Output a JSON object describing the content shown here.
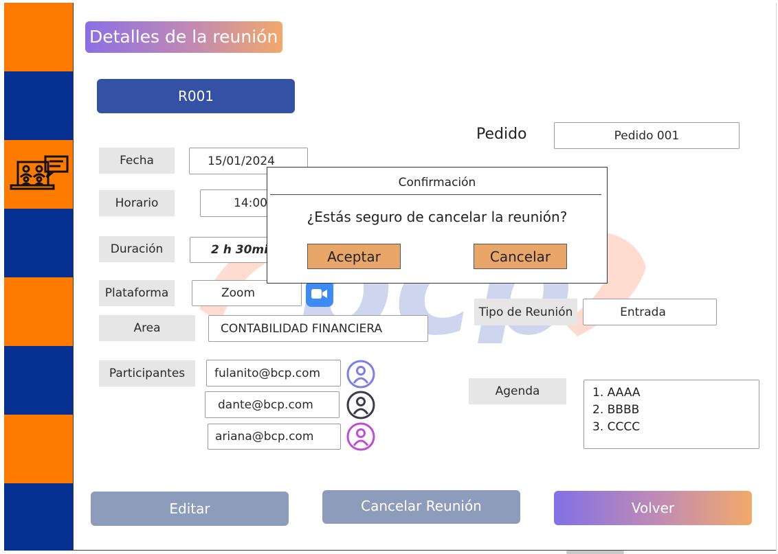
{
  "header": {
    "title": "Detalles de la reunión"
  },
  "meeting": {
    "code": "R001",
    "pedido_label": "Pedido",
    "pedido_value": "Pedido 001",
    "fields": {
      "fecha_label": "Fecha",
      "fecha_value": "15/01/2024",
      "horario_label": "Horario",
      "horario_value": "14:00",
      "duracion_label": "Duración",
      "duracion_value": "2 h 30mi",
      "plataforma_label": "Plataforma",
      "plataforma_value": "Zoom",
      "area_label": "Area",
      "area_value": "CONTABILIDAD FINANCIERA",
      "tipo_label": "Tipo de Reunión",
      "tipo_value": "Entrada",
      "participantes_label": "Participantes",
      "agenda_label": "Agenda"
    },
    "participants": [
      {
        "email": "fulanito@bcp.com",
        "avatar_icon": "user-circle-icon",
        "color": "#7b7de8"
      },
      {
        "email": "dante@bcp.com",
        "avatar_icon": "user-circle-icon",
        "color": "#3a3a4a"
      },
      {
        "email": "ariana@bcp.com",
        "avatar_icon": "user-circle-icon",
        "color": "#c04bd6"
      }
    ],
    "agenda": [
      "1. AAAA",
      "2. BBBB",
      "3. CCCC"
    ]
  },
  "actions": {
    "edit": "Editar",
    "cancel_meeting": "Cancelar Reunión",
    "back": "Volver"
  },
  "modal": {
    "title": "Confirmación",
    "message": "¿Estás seguro de cancelar la reunión?",
    "accept": "Aceptar",
    "cancel": "Cancelar"
  },
  "colors": {
    "sidebar_orange": "#ff7b00",
    "sidebar_blue": "#052f91",
    "primary": "#3451a6",
    "muted_button": "#8d9cbb",
    "modal_button": "#e8a768"
  },
  "icons": {
    "sidebar": "meeting-presentation-icon",
    "platform": "zoom-video-icon"
  }
}
